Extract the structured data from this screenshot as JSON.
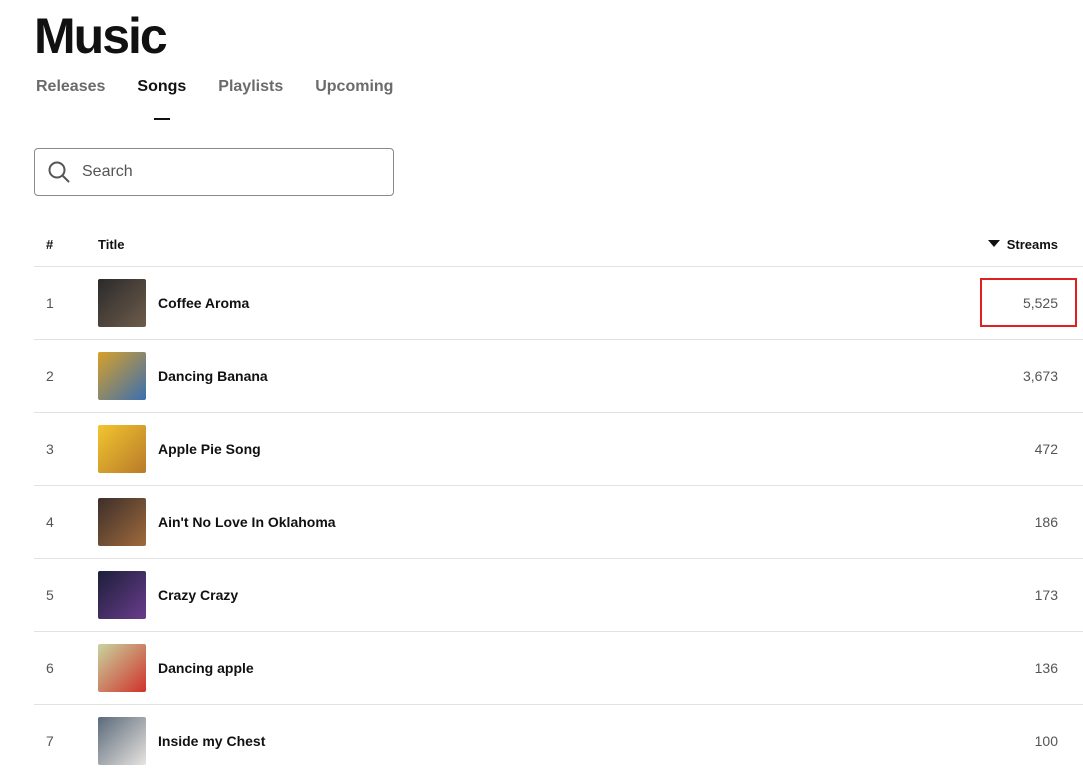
{
  "page": {
    "title": "Music"
  },
  "tabs": [
    {
      "label": "Releases",
      "active": false
    },
    {
      "label": "Songs",
      "active": true
    },
    {
      "label": "Playlists",
      "active": false
    },
    {
      "label": "Upcoming",
      "active": false
    }
  ],
  "search": {
    "placeholder": "Search",
    "value": ""
  },
  "table": {
    "headers": {
      "num": "#",
      "title": "Title",
      "streams": "Streams"
    },
    "sort": {
      "column": "Streams",
      "direction": "descending"
    },
    "rows": [
      {
        "num": "1",
        "title": "Coffee Aroma",
        "streams": "5,525",
        "art_colors": [
          "#2b2a2a",
          "#6e5c4c"
        ]
      },
      {
        "num": "2",
        "title": "Dancing Banana",
        "streams": "3,673",
        "art_colors": [
          "#d8a02a",
          "#3a6fb0"
        ]
      },
      {
        "num": "3",
        "title": "Apple Pie Song",
        "streams": "472",
        "art_colors": [
          "#f2c52e",
          "#b87a2a"
        ]
      },
      {
        "num": "4",
        "title": "Ain't No Love In Oklahoma",
        "streams": "186",
        "art_colors": [
          "#3c2f2a",
          "#a06a3c"
        ]
      },
      {
        "num": "5",
        "title": "Crazy Crazy",
        "streams": "173",
        "art_colors": [
          "#1c1f3a",
          "#6a3c8c"
        ]
      },
      {
        "num": "6",
        "title": "Dancing apple",
        "streams": "136",
        "art_colors": [
          "#c8d4a0",
          "#d0322a"
        ]
      },
      {
        "num": "7",
        "title": "Inside my Chest",
        "streams": "100",
        "art_colors": [
          "#5a6a7a",
          "#e8e4e0"
        ]
      }
    ]
  },
  "colors": {
    "highlight": "#e02020",
    "divider": "#e2e2e2"
  }
}
